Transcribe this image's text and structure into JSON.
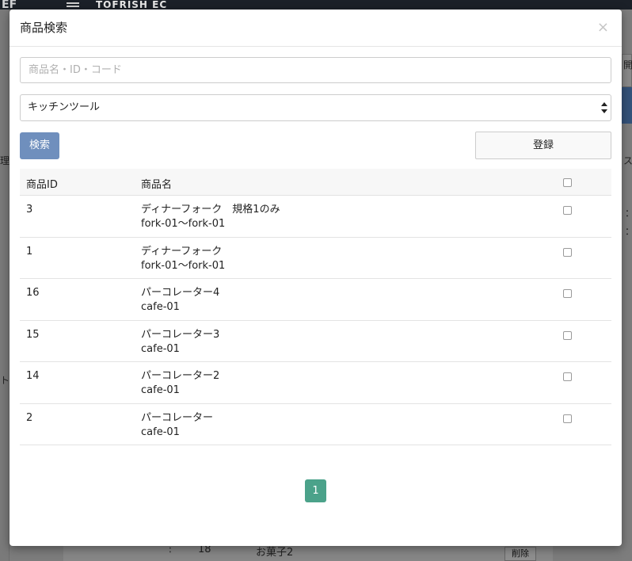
{
  "background": {
    "logo": "EF",
    "shop_name": "TOFRISH EC",
    "left_fragments": [
      "理",
      "ト"
    ],
    "right_fragments": [
      "開",
      "ス",
      "：",
      "："
    ],
    "row_number": "18",
    "row_name": "お菓子2",
    "row_menu": "⋮",
    "delete_label": "削除"
  },
  "modal": {
    "title": "商品検索",
    "close_glyph": "×",
    "search": {
      "placeholder": "商品名・ID・コード",
      "value": ""
    },
    "category": {
      "selected": "キッチンツール"
    },
    "search_button": "検索",
    "register_button": "登録",
    "table": {
      "headers": {
        "id": "商品ID",
        "name": "商品名"
      },
      "rows": [
        {
          "id": "3",
          "name": "ディナーフォーク　規格1のみ",
          "code": "fork-01～fork-01"
        },
        {
          "id": "1",
          "name": "ディナーフォーク",
          "code": "fork-01～fork-01"
        },
        {
          "id": "16",
          "name": "パーコレーター4",
          "code": "cafe-01"
        },
        {
          "id": "15",
          "name": "パーコレーター3",
          "code": "cafe-01"
        },
        {
          "id": "14",
          "name": "パーコレーター2",
          "code": "cafe-01"
        },
        {
          "id": "2",
          "name": "パーコレーター",
          "code": "cafe-01"
        }
      ]
    },
    "pagination": {
      "current": "1"
    }
  },
  "colors": {
    "search_button": "#6f8fbd",
    "pagination_active": "#4ba28a",
    "topbar": "#1b2028"
  }
}
